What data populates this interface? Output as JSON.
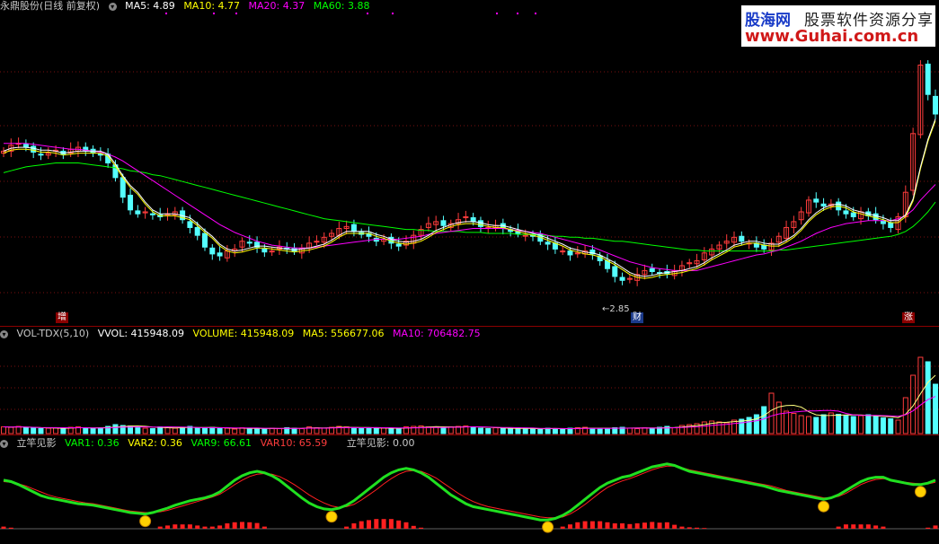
{
  "main_header": {
    "title": "永鼎股份(日线 前复权)",
    "ma5": "MA5: 4.89",
    "ma10": "MA10: 4.77",
    "ma20": "MA20: 4.37",
    "ma60": "MA60: 3.88"
  },
  "vol_header": {
    "title": "VOL-TDX(5,10)",
    "vvol": "VVOL: 415948.09",
    "volume": "VOLUME: 415948.09",
    "ma5": "MA5: 556677.06",
    "ma10": "MA10: 706482.75"
  },
  "ind_header": {
    "title": "立竿见影",
    "var1": "VAR1: 0.36",
    "var2": "VAR2: 0.36",
    "var9": "VAR9: 66.61",
    "var10": "VAR10: 65.59",
    "lgjy": "立竿见影: 0.00"
  },
  "markers": {
    "zeng": "增",
    "cai": "财",
    "zhang": "涨",
    "low_label": "2.85"
  },
  "logo": {
    "name": "股海网",
    "slogan": "股票软件资源分享",
    "url": "www.Guhai.com.cn"
  },
  "colors": {
    "up": "#ff3c3c",
    "down": "#54ffff",
    "ma5": "#ffffff",
    "ma10": "#ffff00",
    "ma20": "#ff00ff",
    "ma60": "#00ff00",
    "separator": "#8b0000"
  },
  "chart_data": [
    {
      "type": "candlestick",
      "title": "永鼎股份(日线 前复权)",
      "ylim": [
        2.6,
        5.6
      ],
      "lowest_marked": 2.85,
      "close": [
        4.22,
        4.28,
        4.3,
        4.26,
        4.21,
        4.18,
        4.2,
        4.23,
        4.19,
        4.24,
        4.26,
        4.22,
        4.2,
        4.18,
        4.1,
        3.95,
        3.75,
        3.62,
        3.58,
        3.6,
        3.57,
        3.55,
        3.58,
        3.6,
        3.52,
        3.44,
        3.36,
        3.24,
        3.17,
        3.15,
        3.2,
        3.22,
        3.3,
        3.28,
        3.24,
        3.19,
        3.2,
        3.24,
        3.22,
        3.2,
        3.23,
        3.28,
        3.3,
        3.34,
        3.38,
        3.43,
        3.45,
        3.4,
        3.37,
        3.35,
        3.3,
        3.32,
        3.28,
        3.25,
        3.3,
        3.36,
        3.42,
        3.48,
        3.5,
        3.46,
        3.48,
        3.52,
        3.55,
        3.5,
        3.45,
        3.44,
        3.46,
        3.43,
        3.4,
        3.38,
        3.36,
        3.35,
        3.3,
        3.27,
        3.22,
        3.2,
        3.16,
        3.18,
        3.2,
        3.17,
        3.1,
        3.02,
        2.94,
        2.9,
        2.92,
        2.96,
        3.0,
        2.99,
        2.98,
        2.97,
        3.0,
        3.05,
        3.08,
        3.1,
        3.18,
        3.22,
        3.26,
        3.3,
        3.34,
        3.3,
        3.28,
        3.24,
        3.22,
        3.28,
        3.35,
        3.44,
        3.5,
        3.6,
        3.72,
        3.7,
        3.66,
        3.68,
        3.62,
        3.58,
        3.55,
        3.6,
        3.56,
        3.52,
        3.48,
        3.44,
        3.55,
        3.8,
        4.4,
        5.1,
        4.8,
        4.6
      ],
      "ma5": [
        4.22,
        4.25,
        4.26,
        4.26,
        4.25,
        4.23,
        4.23,
        4.22,
        4.2,
        4.21,
        4.22,
        4.22,
        4.22,
        4.22,
        4.19,
        4.09,
        3.97,
        3.87,
        3.8,
        3.7,
        3.62,
        3.58,
        3.58,
        3.58,
        3.56,
        3.54,
        3.48,
        3.41,
        3.35,
        3.27,
        3.22,
        3.2,
        3.21,
        3.23,
        3.25,
        3.25,
        3.24,
        3.23,
        3.22,
        3.21,
        3.22,
        3.23,
        3.25,
        3.27,
        3.31,
        3.36,
        3.4,
        3.4,
        3.4,
        3.4,
        3.37,
        3.35,
        3.32,
        3.3,
        3.29,
        3.3,
        3.32,
        3.36,
        3.41,
        3.44,
        3.47,
        3.49,
        3.5,
        3.5,
        3.49,
        3.47,
        3.46,
        3.46,
        3.44,
        3.42,
        3.4,
        3.38,
        3.36,
        3.33,
        3.3,
        3.27,
        3.23,
        3.21,
        3.19,
        3.18,
        3.16,
        3.12,
        3.08,
        3.03,
        2.98,
        2.95,
        2.94,
        2.95,
        2.97,
        2.98,
        2.99,
        3.0,
        3.02,
        3.04,
        3.08,
        3.13,
        3.17,
        3.21,
        3.26,
        3.28,
        3.3,
        3.3,
        3.28,
        3.27,
        3.27,
        3.31,
        3.36,
        3.43,
        3.52,
        3.59,
        3.64,
        3.67,
        3.68,
        3.66,
        3.62,
        3.6,
        3.58,
        3.56,
        3.54,
        3.51,
        3.51,
        3.57,
        3.73,
        4.06,
        4.34,
        4.55
      ],
      "ma20": [
        4.3,
        4.3,
        4.3,
        4.3,
        4.29,
        4.28,
        4.27,
        4.26,
        4.25,
        4.24,
        4.24,
        4.23,
        4.22,
        4.21,
        4.19,
        4.16,
        4.12,
        4.07,
        4.02,
        3.97,
        3.92,
        3.87,
        3.82,
        3.77,
        3.72,
        3.67,
        3.62,
        3.57,
        3.52,
        3.47,
        3.43,
        3.39,
        3.36,
        3.33,
        3.3,
        3.28,
        3.26,
        3.25,
        3.24,
        3.23,
        3.23,
        3.23,
        3.24,
        3.25,
        3.26,
        3.27,
        3.28,
        3.29,
        3.3,
        3.31,
        3.32,
        3.32,
        3.32,
        3.32,
        3.33,
        3.34,
        3.35,
        3.37,
        3.38,
        3.39,
        3.4,
        3.41,
        3.42,
        3.43,
        3.43,
        3.43,
        3.43,
        3.43,
        3.42,
        3.41,
        3.4,
        3.39,
        3.38,
        3.36,
        3.34,
        3.32,
        3.3,
        3.28,
        3.26,
        3.24,
        3.21,
        3.18,
        3.15,
        3.12,
        3.09,
        3.07,
        3.05,
        3.03,
        3.02,
        3.01,
        3.0,
        3.0,
        3.0,
        3.0,
        3.02,
        3.04,
        3.06,
        3.08,
        3.1,
        3.12,
        3.14,
        3.16,
        3.17,
        3.19,
        3.21,
        3.24,
        3.27,
        3.3,
        3.34,
        3.38,
        3.41,
        3.44,
        3.46,
        3.48,
        3.49,
        3.5,
        3.51,
        3.51,
        3.51,
        3.51,
        3.53,
        3.56,
        3.62,
        3.72,
        3.8,
        3.88
      ],
      "ma60": [
        4.0,
        4.02,
        4.04,
        4.06,
        4.07,
        4.08,
        4.09,
        4.1,
        4.1,
        4.1,
        4.1,
        4.09,
        4.08,
        4.07,
        4.06,
        4.05,
        4.04,
        4.02,
        4.01,
        4.0,
        3.98,
        3.97,
        3.95,
        3.93,
        3.91,
        3.89,
        3.87,
        3.85,
        3.83,
        3.81,
        3.79,
        3.77,
        3.75,
        3.73,
        3.71,
        3.69,
        3.67,
        3.65,
        3.63,
        3.61,
        3.59,
        3.57,
        3.55,
        3.53,
        3.52,
        3.51,
        3.5,
        3.49,
        3.48,
        3.47,
        3.46,
        3.45,
        3.44,
        3.43,
        3.42,
        3.42,
        3.41,
        3.41,
        3.4,
        3.4,
        3.4,
        3.4,
        3.39,
        3.39,
        3.39,
        3.38,
        3.38,
        3.38,
        3.38,
        3.37,
        3.37,
        3.37,
        3.36,
        3.36,
        3.35,
        3.35,
        3.34,
        3.34,
        3.33,
        3.33,
        3.32,
        3.31,
        3.3,
        3.3,
        3.29,
        3.28,
        3.27,
        3.26,
        3.25,
        3.24,
        3.23,
        3.22,
        3.21,
        3.21,
        3.2,
        3.2,
        3.2,
        3.2,
        3.2,
        3.2,
        3.2,
        3.2,
        3.2,
        3.2,
        3.21,
        3.21,
        3.22,
        3.23,
        3.24,
        3.25,
        3.26,
        3.27,
        3.28,
        3.29,
        3.3,
        3.31,
        3.32,
        3.33,
        3.34,
        3.35,
        3.37,
        3.4,
        3.45,
        3.52,
        3.6,
        3.7
      ]
    },
    {
      "type": "bar",
      "title": "VOL-TDX(5,10)",
      "ylim": [
        0,
        2000000
      ],
      "volume": [
        150000,
        140000,
        160000,
        130000,
        120000,
        110000,
        120000,
        130000,
        110000,
        140000,
        150000,
        120000,
        110000,
        130000,
        160000,
        200000,
        180000,
        170000,
        140000,
        120000,
        110000,
        150000,
        130000,
        120000,
        140000,
        160000,
        120000,
        130000,
        140000,
        110000,
        120000,
        100000,
        130000,
        120000,
        110000,
        100000,
        120000,
        110000,
        130000,
        120000,
        110000,
        150000,
        130000,
        120000,
        140000,
        160000,
        150000,
        120000,
        110000,
        130000,
        120000,
        130000,
        110000,
        100000,
        150000,
        160000,
        170000,
        150000,
        140000,
        130000,
        150000,
        160000,
        170000,
        140000,
        120000,
        110000,
        130000,
        120000,
        110000,
        100000,
        120000,
        110000,
        100000,
        120000,
        110000,
        100000,
        120000,
        130000,
        140000,
        110000,
        100000,
        120000,
        130000,
        140000,
        120000,
        110000,
        130000,
        120000,
        140000,
        160000,
        130000,
        180000,
        200000,
        220000,
        260000,
        280000,
        260000,
        240000,
        300000,
        320000,
        360000,
        420000,
        600000,
        900000,
        700000,
        500000,
        450000,
        400000,
        380000,
        360000,
        420000,
        460000,
        430000,
        400000,
        380000,
        400000,
        420000,
        380000,
        350000,
        330000,
        300000,
        800000,
        1300000,
        1700000,
        1600000,
        1100000
      ],
      "ma5": "MA5: 556677.06",
      "ma10": "MA10: 706482.75"
    }
  ],
  "indicator": {
    "var9": [
      66,
      64,
      60,
      55,
      50,
      45,
      42,
      40,
      38,
      36,
      34,
      33,
      32,
      30,
      28,
      26,
      24,
      22,
      21,
      20,
      22,
      25,
      28,
      32,
      35,
      38,
      40,
      42,
      45,
      50,
      58,
      66,
      72,
      76,
      78,
      76,
      72,
      66,
      58,
      50,
      42,
      35,
      30,
      27,
      26,
      28,
      32,
      38,
      46,
      54,
      62,
      70,
      76,
      80,
      82,
      80,
      76,
      70,
      62,
      54,
      46,
      40,
      34,
      30,
      28,
      26,
      24,
      22,
      20,
      18,
      16,
      14,
      12,
      12,
      14,
      18,
      24,
      32,
      40,
      48,
      56,
      62,
      66,
      70,
      72,
      76,
      80,
      84,
      86,
      88,
      86,
      82,
      78,
      76,
      74,
      72,
      70,
      68,
      66,
      64,
      62,
      60,
      58,
      55,
      52,
      50,
      48,
      46,
      44,
      42,
      40,
      42,
      46,
      52,
      58,
      64,
      68,
      70,
      70,
      66,
      64,
      62,
      60,
      60,
      62,
      66
    ],
    "var10": [
      64,
      63,
      61,
      58,
      54,
      50,
      46,
      43,
      41,
      39,
      37,
      35,
      34,
      32,
      30,
      28,
      26,
      24,
      23,
      22,
      22,
      23,
      25,
      28,
      31,
      34,
      37,
      40,
      43,
      47,
      53,
      60,
      66,
      71,
      74,
      75,
      74,
      71,
      66,
      60,
      53,
      46,
      40,
      35,
      31,
      29,
      30,
      33,
      39,
      46,
      53,
      61,
      68,
      74,
      78,
      79,
      78,
      74,
      69,
      62,
      55,
      48,
      42,
      37,
      33,
      30,
      28,
      26,
      24,
      22,
      20,
      18,
      16,
      15,
      15,
      16,
      20,
      26,
      33,
      41,
      49,
      56,
      61,
      65,
      68,
      72,
      76,
      80,
      83,
      85,
      85,
      83,
      80,
      78,
      76,
      74,
      72,
      70,
      68,
      66,
      64,
      62,
      60,
      58,
      55,
      52,
      50,
      48,
      46,
      44,
      42,
      42,
      44,
      48,
      54,
      60,
      64,
      67,
      68,
      67,
      65,
      63,
      62,
      61,
      61,
      63
    ]
  }
}
